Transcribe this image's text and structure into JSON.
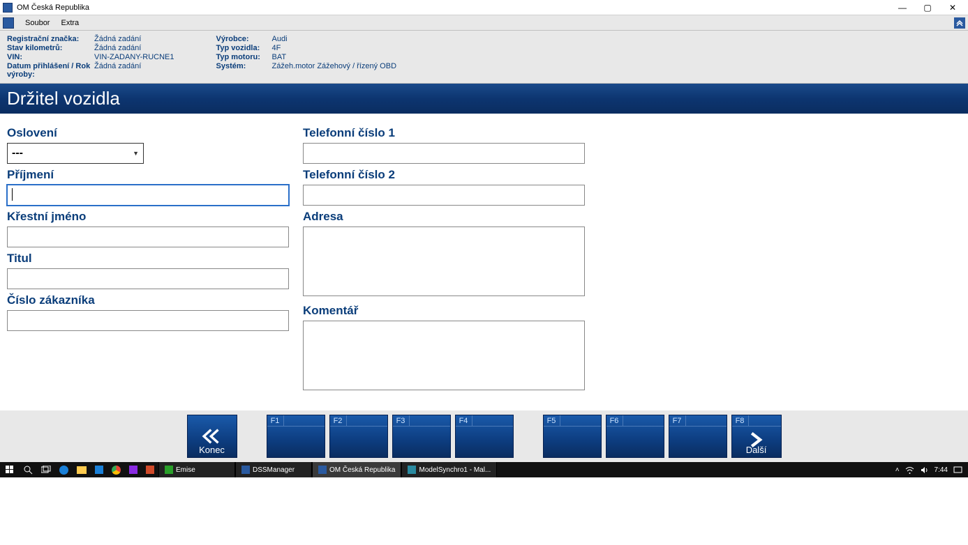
{
  "window": {
    "title": "OM Česká Republika",
    "minimize": "—",
    "maximize": "▢",
    "close": "✕"
  },
  "menubar": {
    "items": [
      "Soubor",
      "Extra"
    ]
  },
  "info": {
    "col1": [
      {
        "label": "Registrační značka:",
        "value": "Žádná zadání"
      },
      {
        "label": "Stav kilometrů:",
        "value": "Žádná zadání"
      },
      {
        "label": "VIN:",
        "value": "VIN-ZADANY-RUCNE1"
      },
      {
        "label": "Datum přihlášení / Rok výroby:",
        "value": "Žádná zadání"
      }
    ],
    "col2": [
      {
        "label": "Výrobce:",
        "value": "Audi"
      },
      {
        "label": "Typ vozidla:",
        "value": "4F"
      },
      {
        "label": "Typ motoru:",
        "value": "BAT"
      },
      {
        "label": "Systém:",
        "value": "Zážeh.motor Zážehový / řízený OBD"
      }
    ]
  },
  "section_title": "Držitel vozidla",
  "form": {
    "salutation_label": "Oslovení",
    "salutation_value": "---",
    "surname_label": "Příjmení",
    "surname_value": "",
    "firstname_label": "Křestní jméno",
    "firstname_value": "",
    "title_label": "Titul",
    "title_value": "",
    "customer_no_label": "Číslo zákazníka",
    "customer_no_value": "",
    "phone1_label": "Telefonní číslo 1",
    "phone1_value": "",
    "phone2_label": "Telefonní číslo 2",
    "phone2_value": "",
    "address_label": "Adresa",
    "address_value": "",
    "comment_label": "Komentář",
    "comment_value": ""
  },
  "fkeys": {
    "back_caption": "Konec",
    "next_caption": "Další",
    "keys": [
      "F1",
      "F2",
      "F3",
      "F4",
      "F5",
      "F6",
      "F7",
      "F8"
    ]
  },
  "taskbar": {
    "items": [
      {
        "label": "Emise",
        "icon": "app"
      },
      {
        "label": "DSSManager",
        "icon": "app"
      },
      {
        "label": "OM Česká Republika",
        "icon": "app",
        "active": true
      },
      {
        "label": "ModelSynchro1 - Mal...",
        "icon": "app"
      }
    ],
    "time": "7:44"
  }
}
